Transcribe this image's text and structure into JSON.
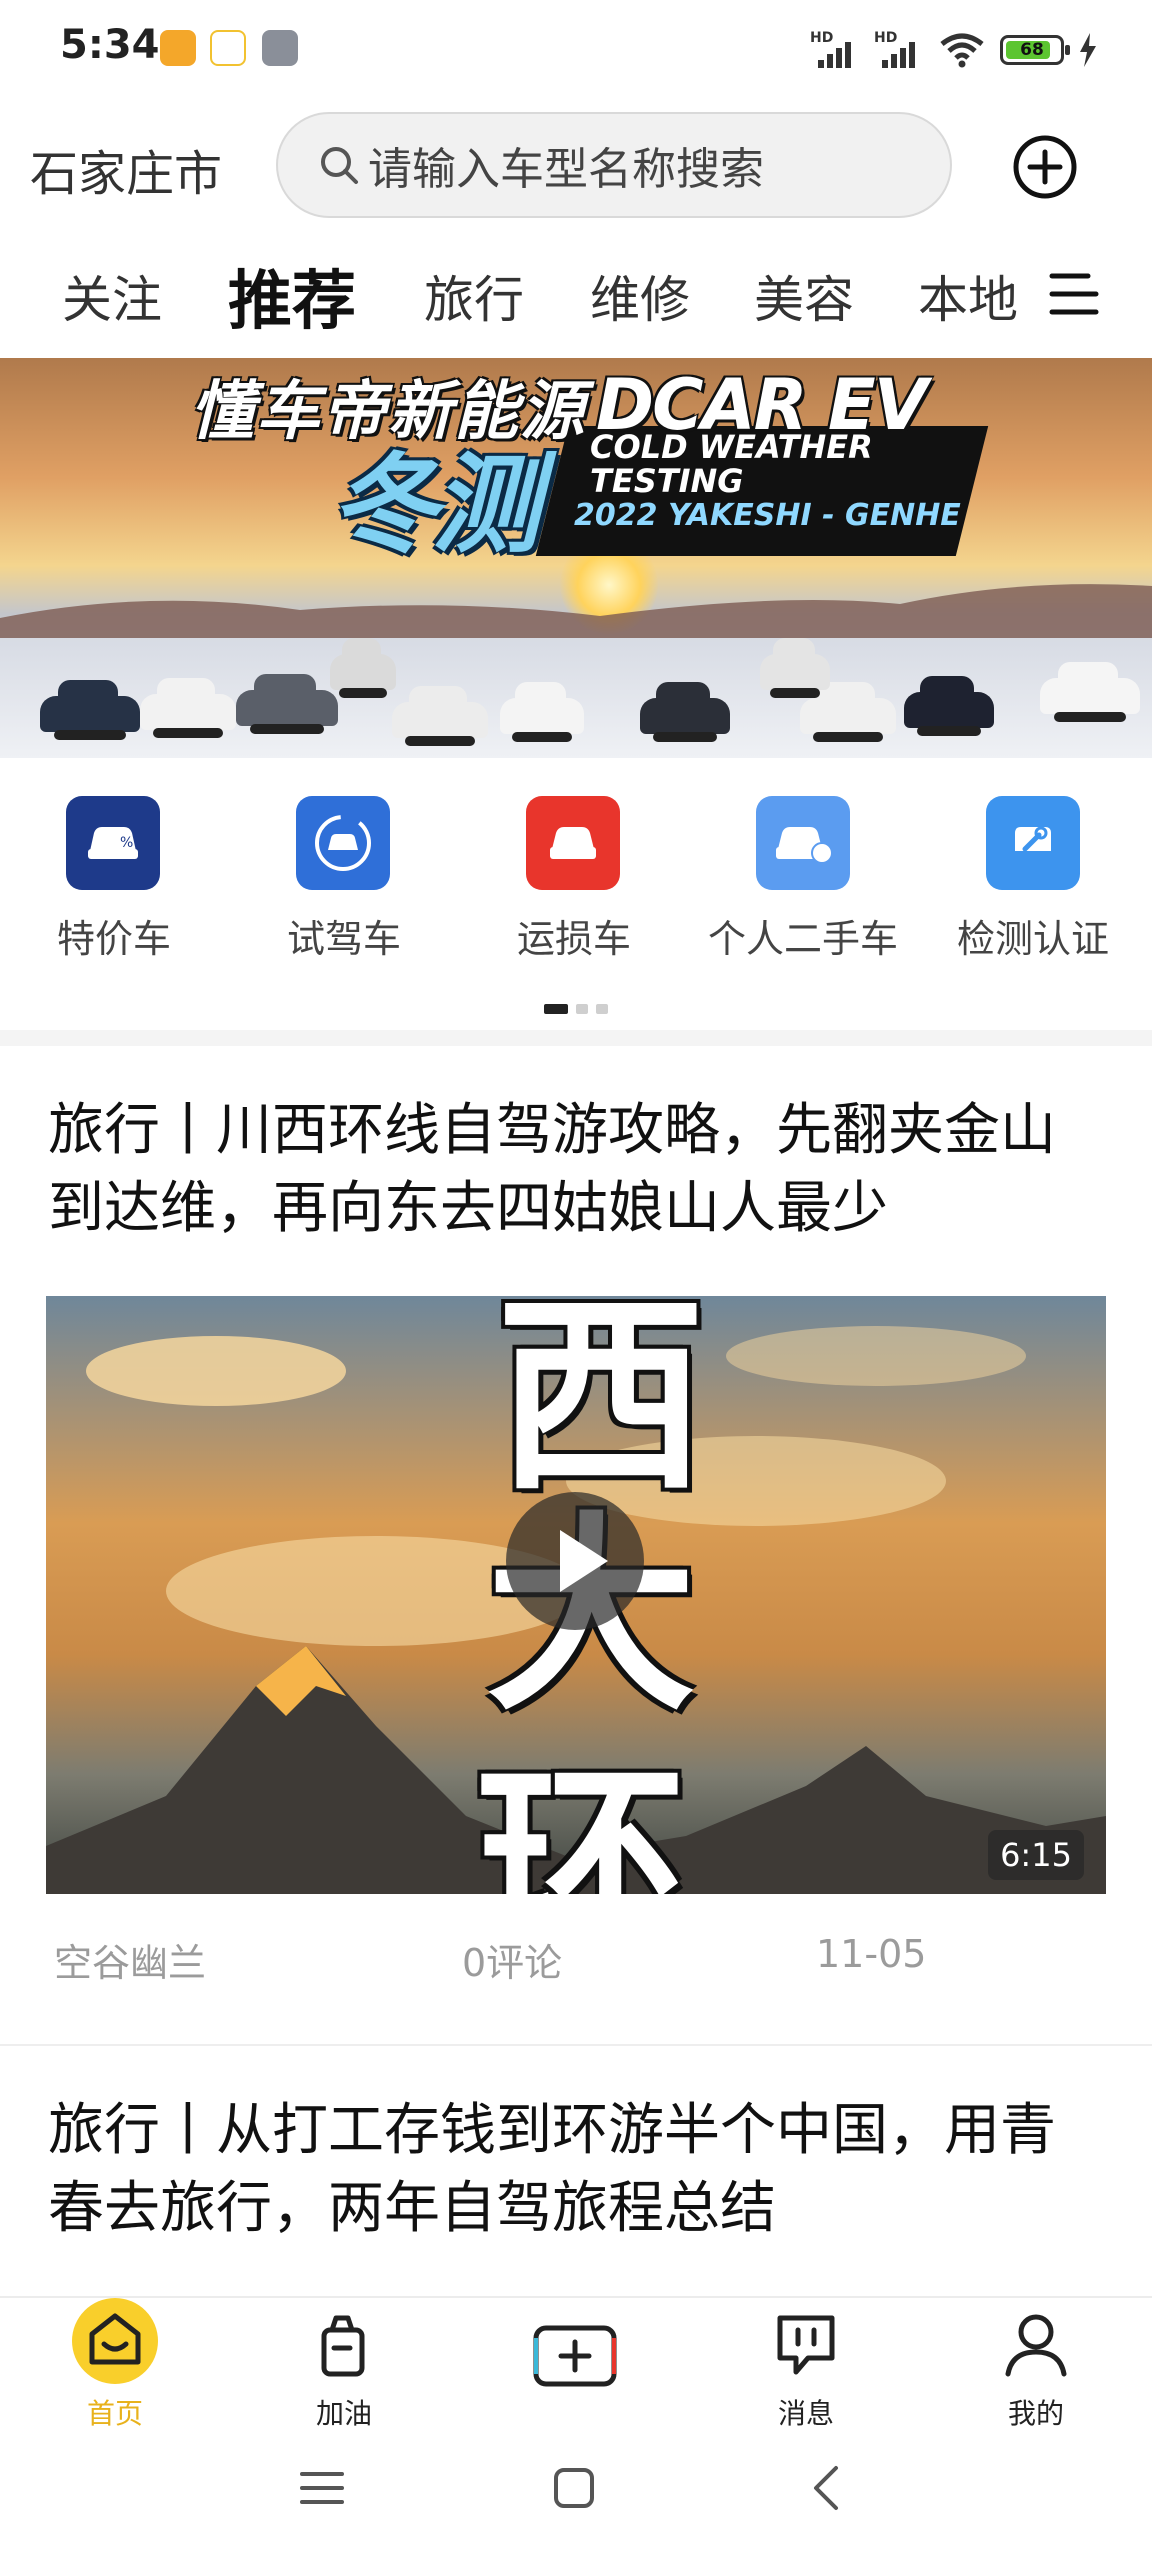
{
  "status_bar": {
    "time": "5:34",
    "signal_labels": [
      "HD",
      "HD"
    ],
    "battery": "68",
    "icons": [
      "app-notification-orange",
      "app-notification-rabbit",
      "tool-icon",
      "signal-icon",
      "signal-icon",
      "wifi-icon",
      "battery-icon",
      "charging-icon"
    ]
  },
  "header": {
    "city": "石家庄市",
    "search_placeholder": "请输入车型名称搜索",
    "add_icon": "plus-circle-icon"
  },
  "tabs": [
    {
      "label": "关注",
      "active": false
    },
    {
      "label": "推荐",
      "active": true
    },
    {
      "label": "旅行",
      "active": false
    },
    {
      "label": "维修",
      "active": false
    },
    {
      "label": "美容",
      "active": false
    },
    {
      "label": "本地",
      "active": false
    }
  ],
  "banner": {
    "title_cn": "懂车帝新能源",
    "title_en": "DCAR EV",
    "subtitle_cn": "冬测",
    "subtitle_en_line1": "COLD WEATHER",
    "subtitle_en_line2": "TESTING",
    "event": "2022 YAKESHI - GENHE"
  },
  "quick_icons": [
    {
      "label": "特价车",
      "icon": "discount-car-icon",
      "color": "#1e3a8a"
    },
    {
      "label": "试驾车",
      "icon": "test-drive-car-icon",
      "color": "#2f6fd8"
    },
    {
      "label": "运损车",
      "icon": "damaged-car-icon",
      "color": "#e8352c"
    },
    {
      "label": "个人二手车",
      "icon": "used-car-icon",
      "color": "#5b9cf0"
    },
    {
      "label": "检测认证",
      "icon": "inspection-wrench-icon",
      "color": "#3d94ee"
    }
  ],
  "carousel": {
    "pages": 3,
    "current": 1
  },
  "articles": [
    {
      "title": "旅行丨川西环线自驾游攻略，先翻夹金山到达维，再向东去四姑娘山人最少",
      "video_overlay_text": [
        "西",
        "大",
        "环"
      ],
      "duration": "6:15",
      "author": "空谷幽兰",
      "comments": "0评论",
      "date": "11-05"
    },
    {
      "title": "旅行丨从打工存钱到环游半个中国，用青春去旅行，两年自驾旅程总结"
    }
  ],
  "bottom_nav": [
    {
      "label": "首页",
      "icon": "home-icon",
      "active": true
    },
    {
      "label": "加油",
      "icon": "fuel-icon",
      "active": false
    },
    {
      "label": "",
      "icon": "publish-plus-icon",
      "active": false
    },
    {
      "label": "消息",
      "icon": "message-icon",
      "active": false
    },
    {
      "label": "我的",
      "icon": "profile-icon",
      "active": false
    }
  ],
  "system_nav": [
    "menu-icon",
    "home-square-icon",
    "back-icon"
  ],
  "colors": {
    "accent": "#f9cf2b",
    "active_label": "#e8b21c"
  }
}
